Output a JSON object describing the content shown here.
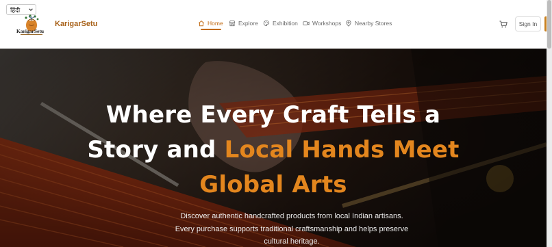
{
  "language_selector": {
    "value": "हिंदी"
  },
  "logo": {
    "text": "KarigarSetu"
  },
  "brand": {
    "name": "KarigarSetu"
  },
  "nav": {
    "items": [
      {
        "label": "Home",
        "icon": "home-icon",
        "active": true
      },
      {
        "label": "Explore",
        "icon": "store-icon"
      },
      {
        "label": "Exhibition",
        "icon": "palette-icon"
      },
      {
        "label": "Workshops",
        "icon": "video-icon"
      },
      {
        "label": "Nearby Stores",
        "icon": "map-pin-icon"
      }
    ]
  },
  "header": {
    "cart_icon": "cart-icon",
    "signin_label": "Sign In"
  },
  "hero": {
    "title_line1": "Where Every Craft Tells a",
    "title_line2_plain": "Story and ",
    "title_line2_accent": "Local Hands Meet",
    "title_line3_accent": "Global Arts",
    "subtitle_line1": "Discover authentic handcrafted products from local Indian artisans.",
    "subtitle_line2": "Every purchase supports traditional craftsmanship and helps preserve",
    "subtitle_line3": "cultural heritage."
  },
  "colors": {
    "accent": "#c26b14",
    "hero_accent": "#e3861e",
    "brand": "#a8621a"
  }
}
